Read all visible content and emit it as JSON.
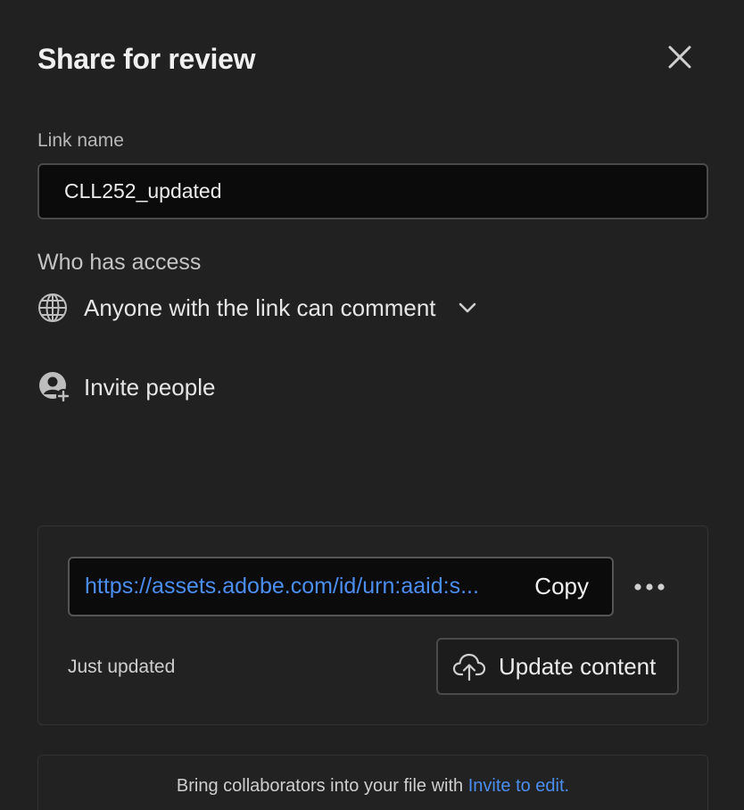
{
  "dialog": {
    "title": "Share for review",
    "close_icon": "close-icon"
  },
  "link_name": {
    "label": "Link name",
    "value": "CLL252_updated"
  },
  "access": {
    "label": "Who has access",
    "selected": "Anyone with the link can comment",
    "icon": "globe-icon",
    "dropdown_icon": "chevron-down-icon"
  },
  "invite": {
    "label": "Invite people",
    "icon": "add-user-icon"
  },
  "share_link": {
    "url": "https://assets.adobe.com/id/urn:aaid:s...",
    "copy_label": "Copy",
    "more_icon": "more-icon",
    "status": "Just updated",
    "update_label": "Update content",
    "update_icon": "cloud-upload-icon"
  },
  "footer": {
    "text": "Bring collaborators into your file with",
    "link": "Invite to edit."
  },
  "colors": {
    "background": "#212121",
    "accent_link": "#4b8ef0",
    "input_bg": "#0b0b0b"
  }
}
